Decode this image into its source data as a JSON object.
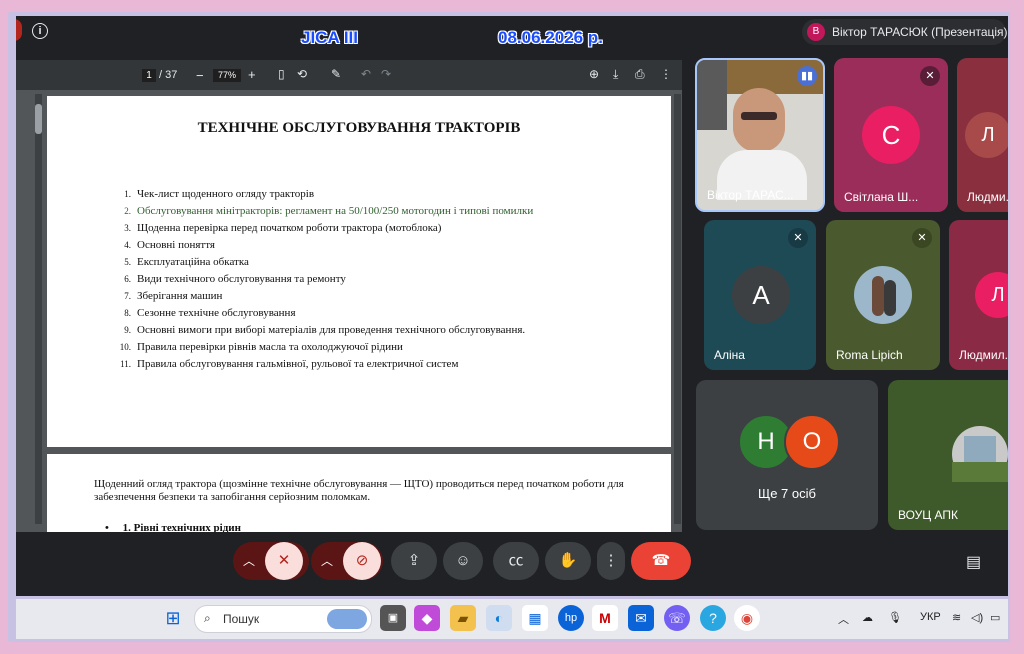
{
  "window": {
    "banner_title": "JICA III",
    "banner_date": "08.06.2026 р.",
    "presenter_initial": "В",
    "presenter_label": "Віктор ТАРАСЮК (Презентація)"
  },
  "pdf_toolbar": {
    "page_current": "1",
    "page_total": "/ 37",
    "zoom_minus": "−",
    "zoom_value": "77%",
    "zoom_plus": "+"
  },
  "document": {
    "title": "ТЕХНІЧНЕ ОБСЛУГОВУВАННЯ ТРАКТОРІВ",
    "toc": [
      {
        "num": "1.",
        "text": "Чек-лист щоденного огляду тракторів"
      },
      {
        "num": "2.",
        "text": "Обслуговування мінітракторів: регламент на 50/100/250 мотогодин і типові помилки"
      },
      {
        "num": "3.",
        "text": "Щоденна перевірка перед початком роботи трактора (мотоблока)"
      },
      {
        "num": "4.",
        "text": "Основні поняття"
      },
      {
        "num": "5.",
        "text": "Експлуатаційна обкатка"
      },
      {
        "num": "6.",
        "text": "Види технічного обслуговування та ремонту"
      },
      {
        "num": "7.",
        "text": "Зберігання машин"
      },
      {
        "num": "8.",
        "text": "Сезонне технічне обслуговування"
      },
      {
        "num": "9.",
        "text": "Основні вимоги при виборі матеріалів для проведення технічного обслуговування."
      },
      {
        "num": "10.",
        "text": "Правила перевірки рівнів масла та охолоджуючої рідини"
      },
      {
        "num": "11.",
        "text": "Правила обслуговування гальмівної, рульової та електричної систем"
      }
    ],
    "page2_text": "Щоденний огляд трактора (щозмінне технічне обслуговування — ЩТО) проводиться перед початком роботи для забезпечення безпеки та запобігання серйозним поломкам.",
    "page2_bullet": "•",
    "page2_heading": "1. Рівні технічних рідин"
  },
  "participants": {
    "p1": {
      "name": "Віктор ТАРАС..."
    },
    "p2": {
      "initial": "С",
      "name": "Світлана Ш..."
    },
    "p3": {
      "initial": "Л",
      "name": "Людми..."
    },
    "p4": {
      "initial": "А",
      "name": "Аліна"
    },
    "p5": {
      "name": "Roma Lipich"
    },
    "p6": {
      "initial": "Л",
      "name": "Людмил..."
    },
    "more": {
      "initial_a": "Н",
      "initial_b": "О",
      "label": "Ще 7 осіб"
    },
    "p7": {
      "name": "ВОУЦ АПК"
    }
  },
  "taskbar": {
    "search_placeholder": "Пошук",
    "language": "УКР"
  },
  "colors": {
    "meet_bg": "#202124",
    "end_call": "#ea4335",
    "avatar_pink": "#e91e63",
    "avatar_green": "#2e7d32",
    "avatar_orange": "#e64a19"
  }
}
